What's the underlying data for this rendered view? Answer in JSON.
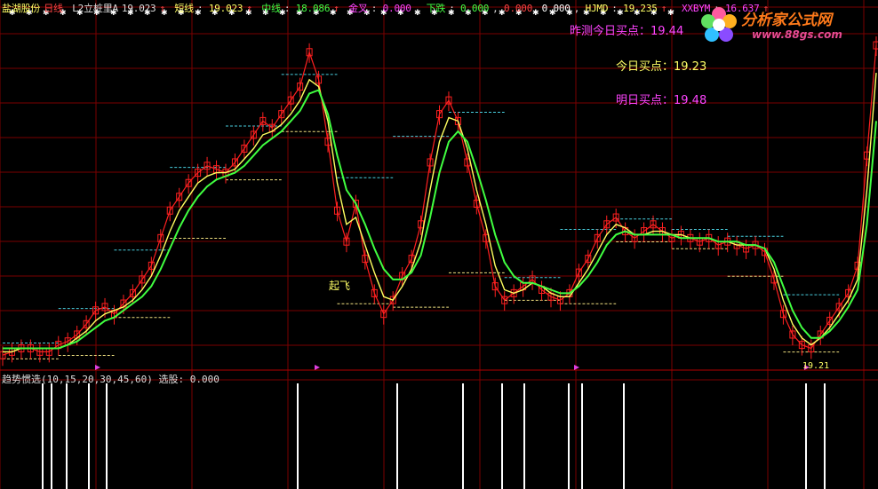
{
  "colors": {
    "grid": "#7a0000",
    "kline": "#ff2020",
    "short": "#ffff60",
    "mid": "#40ff40",
    "step_high": "#4ad0e0",
    "step_low": "#f0e080",
    "spike": "#ffffff",
    "marker": "#e040e0"
  },
  "header": {
    "stock": "盐湖股份",
    "period": "日线",
    "indicator": "L2立桩里A",
    "price": "19.023",
    "short_label": "短线",
    "short_val": "19.023",
    "mid_label": "中线",
    "mid_val": "18.086",
    "golden_label": "金叉",
    "golden_val": "0.000",
    "down_label": "下跌",
    "down_val": "0.000",
    "red_val": "0.000",
    "white_val": "0.000",
    "hjmd_label": "HJMD",
    "hjmd_val": "19.235",
    "xxbym_label": "XXBYM",
    "xxbym_val": "16.637"
  },
  "annotations": {
    "yesterday": "昨测今日买点：19.44",
    "today": "今日买点：19.23",
    "tomorrow": "明日买点：19.48",
    "takeoff": "起飞",
    "low_price": "19.21"
  },
  "sub_header": {
    "name": "趋势惯选(10,15,20,30,45,60)",
    "pick_label": "选股",
    "pick_val": "0.000"
  },
  "logo": {
    "name": "分析家公式网",
    "url": "www.88gs.com"
  },
  "chart_data": {
    "type": "line",
    "series": [
      {
        "name": "K线",
        "values": [
          2,
          3,
          4,
          4,
          3,
          3,
          5,
          6,
          8,
          11,
          15,
          16,
          14,
          17,
          20,
          24,
          28,
          36,
          44,
          48,
          52,
          55,
          57,
          56,
          55,
          58,
          62,
          66,
          70,
          68,
          72,
          76,
          80,
          90,
          82,
          64,
          44,
          35,
          46,
          30,
          20,
          14,
          18,
          25,
          30,
          40,
          58,
          72,
          76,
          70,
          58,
          46,
          36,
          22,
          18,
          20,
          22,
          24,
          21,
          19,
          18,
          20,
          26,
          30,
          36,
          40,
          42,
          38,
          36,
          38,
          40,
          38,
          36,
          37,
          36,
          35,
          36,
          34,
          35,
          34,
          33,
          34,
          32,
          24,
          14,
          8,
          5,
          4,
          8,
          12,
          16,
          20,
          28,
          60,
          92
        ]
      },
      {
        "name": "短线",
        "values": [
          3,
          3,
          4,
          4,
          4,
          4,
          4,
          5,
          7,
          9,
          12,
          14,
          15,
          16,
          18,
          21,
          25,
          31,
          38,
          44,
          48,
          52,
          54,
          55,
          55,
          56,
          59,
          62,
          66,
          67,
          69,
          72,
          76,
          82,
          80,
          70,
          52,
          40,
          42,
          34,
          26,
          19,
          18,
          22,
          27,
          35,
          50,
          64,
          71,
          70,
          62,
          50,
          40,
          28,
          21,
          20,
          21,
          23,
          22,
          20,
          19,
          19,
          23,
          27,
          32,
          37,
          40,
          39,
          37,
          37,
          38,
          38,
          37,
          37,
          36,
          36,
          36,
          35,
          35,
          34,
          34,
          34,
          33,
          27,
          18,
          11,
          7,
          5,
          7,
          10,
          14,
          18,
          24,
          50,
          84
        ]
      },
      {
        "name": "中线",
        "values": [
          4,
          4,
          4,
          4,
          4,
          4,
          4,
          5,
          6,
          8,
          10,
          12,
          13,
          15,
          17,
          19,
          22,
          27,
          33,
          39,
          44,
          48,
          51,
          53,
          54,
          55,
          57,
          60,
          63,
          65,
          67,
          70,
          73,
          78,
          79,
          72,
          60,
          50,
          46,
          40,
          33,
          27,
          24,
          24,
          26,
          31,
          42,
          55,
          64,
          67,
          64,
          56,
          47,
          37,
          29,
          25,
          23,
          23,
          22,
          21,
          20,
          20,
          22,
          25,
          29,
          34,
          37,
          38,
          37,
          37,
          37,
          37,
          37,
          36,
          36,
          36,
          36,
          35,
          35,
          35,
          34,
          34,
          33,
          29,
          22,
          15,
          10,
          7,
          7,
          9,
          12,
          16,
          21,
          40,
          70
        ]
      }
    ],
    "sub_series": {
      "name": "趋势惯选(10,15,20,30,45,60)",
      "spikes_x": [
        48,
        58,
        75,
        100,
        120,
        335,
        447,
        521,
        565,
        590,
        640,
        655,
        702,
        907,
        928
      ]
    },
    "ylim": [
      0,
      100
    ]
  }
}
